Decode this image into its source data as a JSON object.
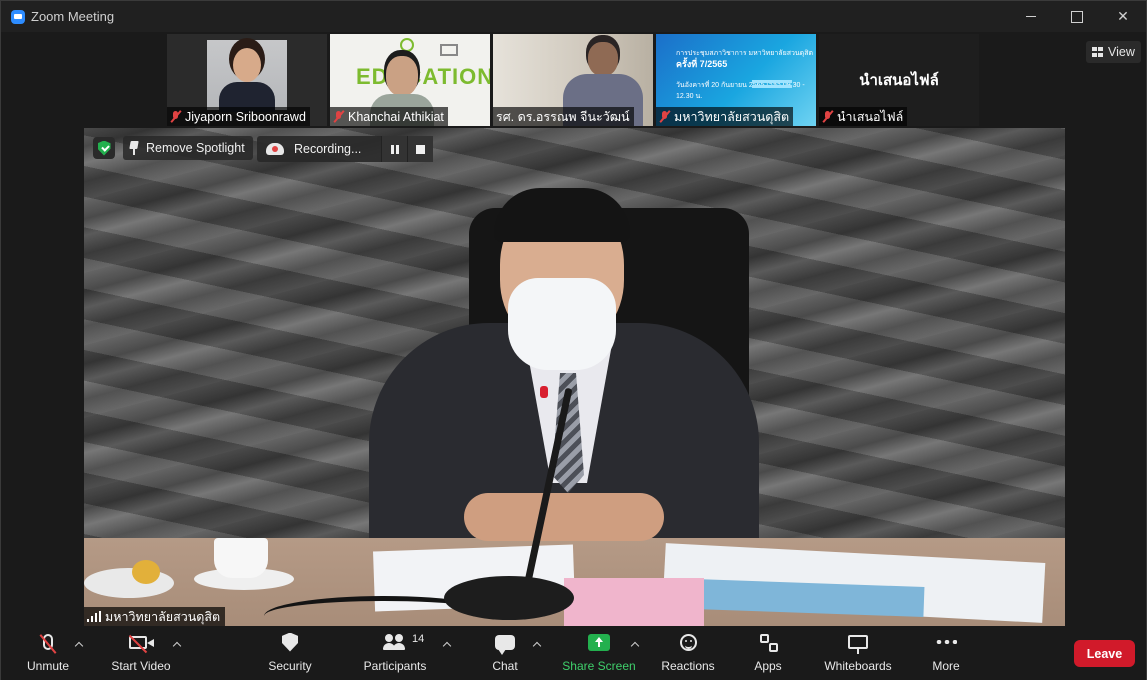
{
  "window": {
    "title": "Zoom Meeting"
  },
  "thumbnails": [
    {
      "name": "Jiyaporn Sriboonrawd",
      "muted": true
    },
    {
      "name": "Khanchai Athikiat",
      "muted": true
    },
    {
      "name": "รศ. ดร.อรรณพ จีนะวัฒน์",
      "muted": true
    },
    {
      "name": "มหาวิทยาลัยสวนดุสิต",
      "muted": true
    },
    {
      "name": "นำเสนอไฟล์",
      "muted": true,
      "center_label": "นำเสนอไฟล์"
    }
  ],
  "thumb_video_text": {
    "edu_word": "EDUCATION",
    "slide_line1": "การประชุมสภาวิชาการ มหาวิทยาลัยสวนดุสิต",
    "slide_line2": "ครั้งที่ 7/2565",
    "slide_line3": "วันอังคารที่ 20 กันยายน 2565 เวลา 09.30 - 12.30 น."
  },
  "view_button": {
    "label": "View"
  },
  "overlay": {
    "spotlight_label": "Remove Spotlight",
    "recording_label": "Recording..."
  },
  "main_speaker": {
    "name": "มหาวิทยาลัยสวนดุสิต"
  },
  "toolbar": {
    "unmute": "Unmute",
    "start_video": "Start Video",
    "security": "Security",
    "participants": "Participants",
    "participants_count": "14",
    "chat": "Chat",
    "share_screen": "Share Screen",
    "reactions": "Reactions",
    "apps": "Apps",
    "whiteboards": "Whiteboards",
    "more": "More",
    "leave": "Leave"
  },
  "colors": {
    "share_green": "#23b04e",
    "leave_red": "#d11a2a",
    "muted_red": "#e04343",
    "accent_blue": "#2d8cff"
  }
}
